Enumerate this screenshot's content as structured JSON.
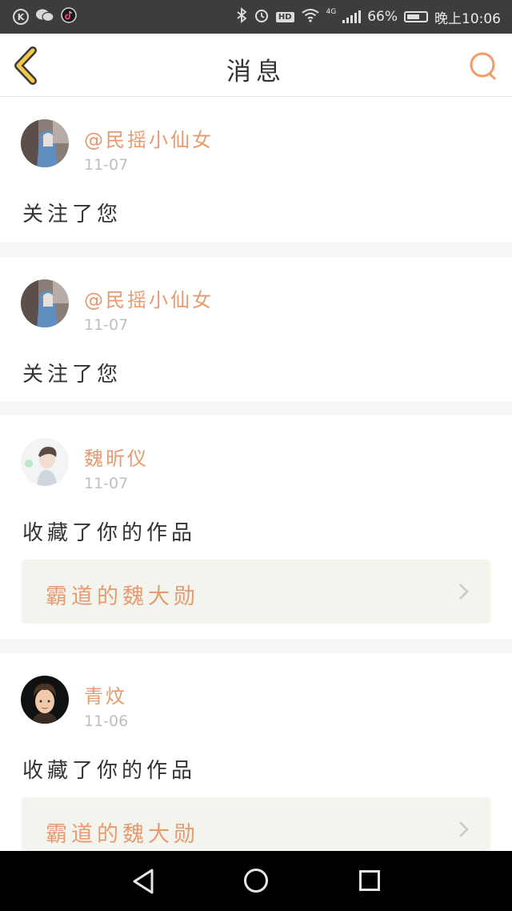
{
  "status_bar": {
    "left_icons": [
      "k-app-icon",
      "wechat-icon",
      "tiktok-icon"
    ],
    "k_letter": "K",
    "right_icons": [
      "bluetooth-icon",
      "alarm-icon",
      "hd-icon",
      "wifi-icon",
      "signal-icon",
      "battery-icon"
    ],
    "hd_label": "HD",
    "network_label": "4G",
    "battery": "66%",
    "battery_level": 0.66,
    "time": "晚上10:06"
  },
  "header": {
    "title": "消息",
    "accent": "#e69a6f",
    "back_color": "#f2c94c"
  },
  "messages": [
    {
      "name": "@民摇小仙女",
      "date": "11-07",
      "action": "关注了您",
      "avatar": "girl-photo"
    },
    {
      "name": "@民摇小仙女",
      "date": "11-07",
      "action": "关注了您",
      "avatar": "girl-photo"
    },
    {
      "name": "魏昕仪",
      "date": "11-07",
      "action": "收藏了你的作品",
      "avatar": "boy-photo",
      "work_title": "霸道的魏大勋"
    },
    {
      "name": "青炆",
      "date": "11-06",
      "action": "收藏了你的作品",
      "avatar": "cartoon-boy",
      "work_title": "霸道的魏大勋"
    }
  ],
  "nav_bar": {
    "icons": [
      "nav-back-icon",
      "nav-home-icon",
      "nav-recent-icon"
    ]
  }
}
